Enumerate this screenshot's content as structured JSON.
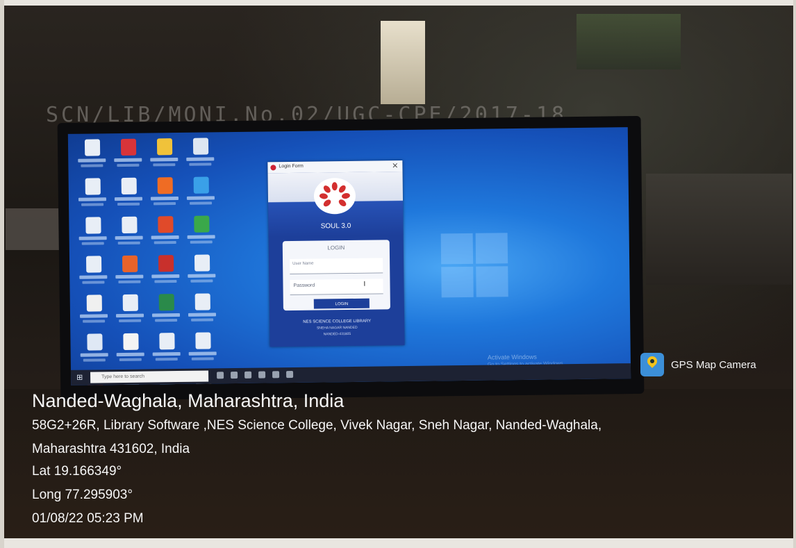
{
  "photo_label_strip": "SCN/LIB/MONI.No.02/UGC-CPE/2017-18",
  "login_window": {
    "title": "Login Form",
    "close_glyph": "✕",
    "app_name": "SOUL 3.0",
    "panel_heading": "LOGIN",
    "username_placeholder": "User Name",
    "password_placeholder": "Password",
    "login_button": "LOGIN",
    "footer_line1": "NES SCIENCE COLLEGE LIBRARY",
    "footer_line2": "SNEHA NAGAR NANDED",
    "footer_line3": "NANDED-431605"
  },
  "desktop": {
    "icon_colors": [
      "#e8eef6",
      "#d8343a",
      "#f0c23a",
      "#dde6f2",
      "#e8eef6",
      "#e9eef6",
      "#ef6c24",
      "#3aa0e8",
      "#e8eef6",
      "#e8eef6",
      "#e04a2a",
      "#3aa84a",
      "#e8eef6",
      "#e8632a",
      "#c8302c",
      "#e8eef6",
      "#f0f0f0",
      "#e8eef6",
      "#2a8a4a",
      "#e8eef6",
      "#dfe8f5",
      "#f4f4f4",
      "#e8eef6",
      "#e8eef6",
      "#c0392b",
      "#9fc8f0",
      "#6fb0e8",
      "#e8eef6",
      "#f39c42",
      "#d63a2a",
      "#e8eef6",
      "#e8eef6",
      "#e8eef6"
    ],
    "activate_windows": "Activate Windows",
    "activate_windows_sub": "Go to Settings to activate Windows.",
    "taskbar_search": "Type here to search"
  },
  "gps_badge": {
    "label": "GPS Map Camera"
  },
  "caption": {
    "place": "Nanded-Waghala, Maharashtra, India",
    "address_line1": "58G2+26R, Library Software ,NES Science College, Vivek Nagar, Sneh Nagar, Nanded-Waghala,",
    "address_line2": "Maharashtra 431602, India",
    "latitude": "Lat 19.166349°",
    "longitude": "Long 77.295903°",
    "timestamp": "01/08/22 05:23 PM"
  }
}
